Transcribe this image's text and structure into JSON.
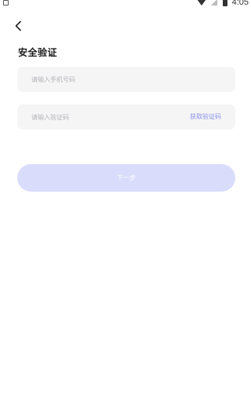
{
  "status_bar": {
    "time": "4:05",
    "icons": [
      "notification-icon",
      "wifi-icon",
      "signal-icon",
      "battery-icon"
    ]
  },
  "header": {
    "back_icon": "chevron-left-icon",
    "title": "安全验证"
  },
  "form": {
    "phone_placeholder": "请输入手机号码",
    "phone_value": "",
    "code_placeholder": "请输入验证码",
    "code_value": "",
    "get_code_label": "获取验证码",
    "next_label": "下一步"
  },
  "colors": {
    "accent": "#8b92e6",
    "button_disabled_bg": "#d9dcfa",
    "input_bg": "#f5f5f6"
  }
}
